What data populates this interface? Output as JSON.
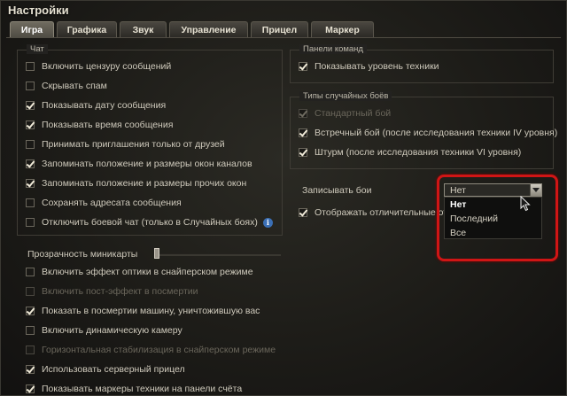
{
  "window": {
    "title": "Настройки"
  },
  "tabs": [
    {
      "label": "Игра",
      "active": true
    },
    {
      "label": "Графика",
      "active": false
    },
    {
      "label": "Звук",
      "active": false
    },
    {
      "label": "Управление",
      "active": false
    },
    {
      "label": "Прицел",
      "active": false
    },
    {
      "label": "Маркер",
      "active": false
    }
  ],
  "chat": {
    "title": "Чат",
    "options": [
      {
        "label": "Включить цензуру сообщений",
        "checked": false,
        "enabled": true
      },
      {
        "label": "Скрывать спам",
        "checked": false,
        "enabled": true
      },
      {
        "label": "Показывать дату сообщения",
        "checked": true,
        "enabled": true
      },
      {
        "label": "Показывать время сообщения",
        "checked": true,
        "enabled": true
      },
      {
        "label": "Принимать приглашения только от друзей",
        "checked": false,
        "enabled": true
      },
      {
        "label": "Запоминать положение и размеры окон каналов",
        "checked": true,
        "enabled": true
      },
      {
        "label": "Запоминать положение и размеры прочих окон",
        "checked": true,
        "enabled": true
      },
      {
        "label": "Сохранять адресата сообщения",
        "checked": false,
        "enabled": true
      },
      {
        "label": "Отключить боевой чат (только в Случайных боях)",
        "checked": false,
        "enabled": true
      }
    ]
  },
  "command_panels": {
    "title": "Панели команд",
    "options": [
      {
        "label": "Показывать уровень техники",
        "checked": true,
        "enabled": true
      }
    ]
  },
  "random_battles": {
    "title": "Типы случайных боёв",
    "options": [
      {
        "label": "Стандартный бой",
        "checked": true,
        "enabled": false
      },
      {
        "label": "Встречный бой (после исследования техники IV уровня)",
        "checked": true,
        "enabled": true
      },
      {
        "label": "Штурм (после исследования техники VI уровня)",
        "checked": true,
        "enabled": true
      }
    ]
  },
  "replay": {
    "label": "Записывать бои",
    "selected": "Нет",
    "options": [
      "Нет",
      "Последний",
      "Все"
    ],
    "highlight_color": "#d01515"
  },
  "distinctive_marks": {
    "label": "Отображать отличительные отмет",
    "checked": true
  },
  "minimap": {
    "label": "Прозрачность миникарты",
    "level": 0
  },
  "game": {
    "options": [
      {
        "label": "Включить эффект оптики в снайперском режиме",
        "checked": false,
        "enabled": true
      },
      {
        "label": "Включить пост-эффект в посмертии",
        "checked": false,
        "enabled": false
      },
      {
        "label": "Показать в посмертии машину, уничтожившую вас",
        "checked": true,
        "enabled": true
      },
      {
        "label": "Включить динамическую камеру",
        "checked": false,
        "enabled": true
      },
      {
        "label": "Горизонтальная стабилизация в снайперском режиме",
        "checked": false,
        "enabled": false
      },
      {
        "label": "Использовать серверный прицел",
        "checked": true,
        "enabled": true
      },
      {
        "label": "Показывать маркеры техники на панели счёта",
        "checked": true,
        "enabled": true
      }
    ]
  },
  "icons": {
    "info": "info-icon",
    "dropdown": "chevron-down-icon",
    "cursor": "mouse-cursor-icon"
  }
}
